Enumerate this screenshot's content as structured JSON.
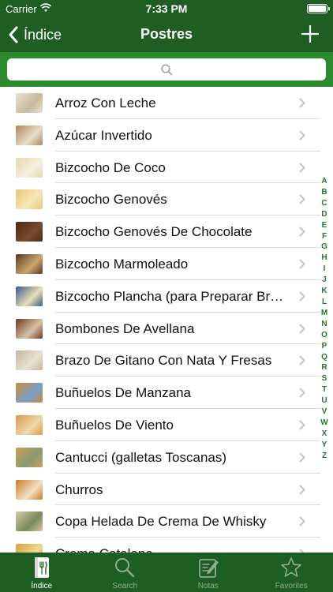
{
  "status": {
    "carrier": "Carrier",
    "time": "7:33 PM"
  },
  "nav": {
    "back_label": "Índice",
    "title": "Postres"
  },
  "search": {
    "placeholder": "",
    "value": ""
  },
  "recipes": [
    {
      "label": "Arroz Con Leche",
      "thumb": [
        "#e9e3d6",
        "#c9b89a"
      ]
    },
    {
      "label": "Azúcar Invertido",
      "thumb": [
        "#b08662",
        "#e8dcc7"
      ]
    },
    {
      "label": "Bizcocho De Coco",
      "thumb": [
        "#e8d7b0",
        "#f6f0e0"
      ]
    },
    {
      "label": "Bizcocho Genovés",
      "thumb": [
        "#e9c77a",
        "#f5e6b8"
      ]
    },
    {
      "label": "Bizcocho Genovés De Chocolate",
      "thumb": [
        "#4a2a18",
        "#7a4a2c"
      ]
    },
    {
      "label": "Bizcocho Marmoleado",
      "thumb": [
        "#5a3a22",
        "#caa56c"
      ]
    },
    {
      "label": "Bizcocho Plancha (para Preparar Brazos)",
      "thumb": [
        "#3a5a88",
        "#e8dfb8"
      ]
    },
    {
      "label": "Bombones De Avellana",
      "thumb": [
        "#6a3a20",
        "#d9c2a8"
      ]
    },
    {
      "label": "Brazo De Gitano Con Nata Y Fresas",
      "thumb": [
        "#c2b69a",
        "#e8e2d4"
      ]
    },
    {
      "label": "Buñuelos De Manzana",
      "thumb": [
        "#c98a3c",
        "#7aa0c8"
      ]
    },
    {
      "label": "Buñuelos De Viento",
      "thumb": [
        "#d49a52",
        "#f0d8a8"
      ]
    },
    {
      "label": "Cantucci  (galletas Toscanas)",
      "thumb": [
        "#c8a060",
        "#8a9a70"
      ]
    },
    {
      "label": "Churros",
      "thumb": [
        "#c87a2c",
        "#f4e2c2"
      ]
    },
    {
      "label": "Copa Helada  De Crema De Whisky",
      "thumb": [
        "#d8c8a8",
        "#7a8a5a"
      ]
    },
    {
      "label": "Crema Catalana",
      "thumb": [
        "#d8a040",
        "#f0d890"
      ]
    }
  ],
  "index_letters": [
    "A",
    "B",
    "C",
    "D",
    "E",
    "F",
    "G",
    "H",
    "I",
    "J",
    "K",
    "L",
    "M",
    "N",
    "O",
    "P",
    "Q",
    "R",
    "S",
    "T",
    "U",
    "V",
    "W",
    "X",
    "Y",
    "Z"
  ],
  "tabs": [
    {
      "label": "Índice",
      "icon": "recipe-book-icon",
      "active": true
    },
    {
      "label": "Search",
      "icon": "search-icon",
      "active": false
    },
    {
      "label": "Notas",
      "icon": "notes-icon",
      "active": false
    },
    {
      "label": "Favorites",
      "icon": "star-icon",
      "active": false
    }
  ],
  "colors": {
    "bar": "#1e5e23",
    "search_bg": "#2a8a2e",
    "index_letter": "#1e7a25",
    "tab_inactive": "#8fae8f"
  }
}
